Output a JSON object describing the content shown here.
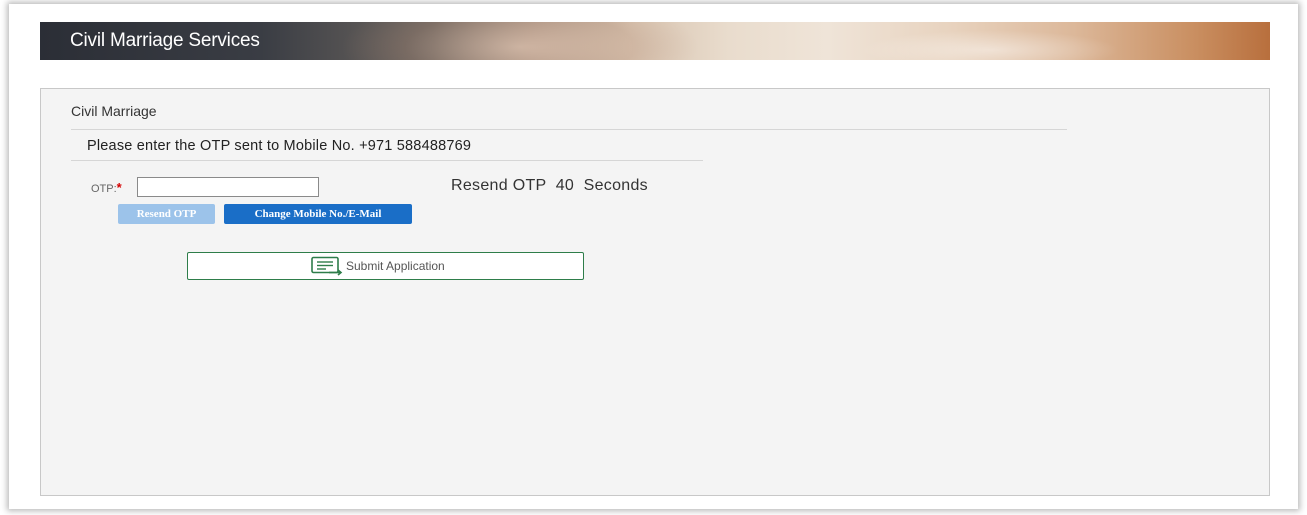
{
  "header": {
    "title": "Civil Marriage Services"
  },
  "form": {
    "section_title": "Civil Marriage",
    "otp_message": "Please enter the OTP sent to Mobile No. +971 588488769",
    "otp_label": "OTP:",
    "required_marker": "*",
    "otp_value": "",
    "resend_timer_label": "Resend OTP",
    "resend_timer_seconds": "40",
    "resend_timer_unit": "Seconds"
  },
  "buttons": {
    "resend_otp": "Resend OTP",
    "change_contact": "Change Mobile No./E-Mail",
    "submit": "Submit Application"
  },
  "icons": {
    "submit": "document-send-icon"
  },
  "colors": {
    "resend_disabled": "#9cc3ea",
    "change_button": "#1a6ec7",
    "submit_border": "#2e7d4a",
    "required": "#d40000"
  }
}
